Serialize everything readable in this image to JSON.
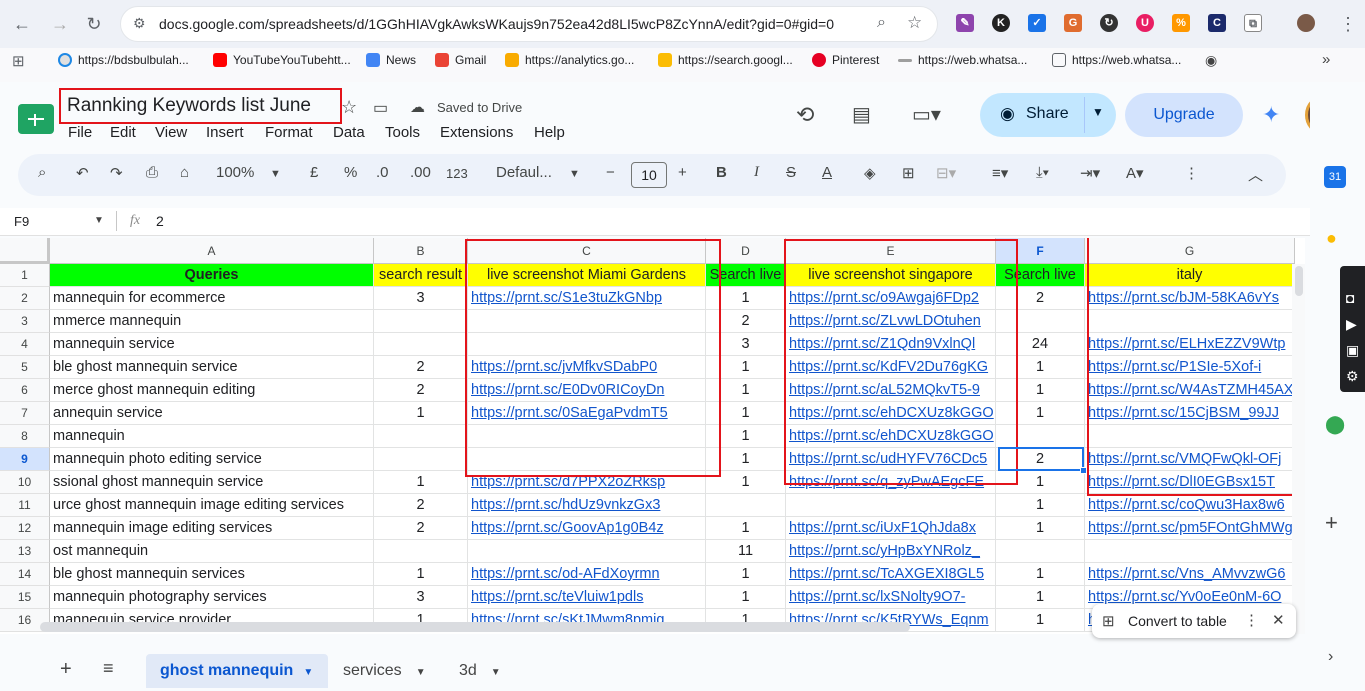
{
  "browser": {
    "url": "docs.google.com/spreadsheets/d/1GGhHIAVgkAwksWKaujs9n752ea42d8LI5wcP8ZcYnnA/edit?gid=0#gid=0",
    "bookmarks": [
      "https://bdsbulbulah...",
      "YouTubeYouTubehtt...",
      "News",
      "Gmail",
      "https://analytics.go...",
      "https://search.googl...",
      "Pinterest",
      "https://web.whatsa...",
      "https://web.whatsa..."
    ],
    "extensions": [
      "K",
      "G",
      "U",
      "M"
    ]
  },
  "doc": {
    "title": "Rannking Keywords list June",
    "saved": "Saved to Drive",
    "menus": [
      "File",
      "Edit",
      "View",
      "Insert",
      "Format",
      "Data",
      "Tools",
      "Extensions",
      "Help"
    ],
    "share": "Share",
    "upgrade": "Upgrade"
  },
  "toolbar": {
    "zoom": "100%",
    "currency": "£",
    "percent": "%",
    "dec_less": ".0",
    "dec_more": ".00",
    "number_fmt": "123",
    "font": "Defaul...",
    "font_size": "10",
    "bold": "B",
    "italic": "I"
  },
  "formula_bar": {
    "cell_ref": "F9",
    "fx": "fx",
    "value": "2"
  },
  "grid": {
    "columns": [
      "A",
      "B",
      "C",
      "D",
      "E",
      "F",
      "G"
    ],
    "rows": [
      "1",
      "2",
      "3",
      "4",
      "5",
      "6",
      "7",
      "8",
      "9",
      "10",
      "11",
      "12",
      "13",
      "14",
      "15",
      "16"
    ],
    "header_row": [
      "Queries",
      "search result",
      "live screenshot Miami Gardens",
      "Search live",
      "live screenshot singapore",
      "Search live",
      "italy"
    ],
    "data": [
      [
        " mannequin for ecommerce",
        "3",
        "https://prnt.sc/S1e3tuZkGNbp",
        "1",
        "https://prnt.sc/o9Awgaj6FDp2",
        "2",
        "https://prnt.sc/bJM-58KA6vYs"
      ],
      [
        "mmerce mannequin",
        "",
        "",
        "2",
        "https://prnt.sc/ZLvwLDOtuhen",
        "",
        ""
      ],
      [
        " mannequin service",
        "",
        "",
        "3",
        "https://prnt.sc/Z1Qdn9VxlnQl",
        "24",
        "https://prnt.sc/ELHxEZZV9Wtp"
      ],
      [
        "ble ghost mannequin service",
        "2",
        "https://prnt.sc/jvMfkvSDabP0",
        "1",
        "https://prnt.sc/KdFV2Du76gKG",
        "1",
        "https://prnt.sc/P1SIe-5Xof-i"
      ],
      [
        "merce ghost mannequin editing",
        "2",
        "https://prnt.sc/E0Dv0RICoyDn",
        "1",
        "https://prnt.sc/aL52MQkvT5-9",
        "1",
        "https://prnt.sc/W4AsTZMH45AX"
      ],
      [
        "annequin service",
        "1",
        "https://prnt.sc/0SaEgaPvdmT5",
        "1",
        "https://prnt.sc/ehDCXUz8kGGO",
        "1",
        "https://prnt.sc/15CjBSM_99JJ"
      ],
      [
        " mannequin",
        "",
        "",
        "1",
        "https://prnt.sc/ehDCXUz8kGGO",
        "",
        ""
      ],
      [
        " mannequin photo editing service",
        "",
        "",
        "1",
        "https://prnt.sc/udHYFV76CDc5",
        "2",
        "https://prnt.sc/VMQFwQkl-OFj"
      ],
      [
        "ssional ghost mannequin service",
        "1",
        "https://prnt.sc/d7PPX2oZRksp",
        "1",
        "https://prnt.sc/q_zyPwAEgcFE",
        "1",
        "https://prnt.sc/DlI0EGBsx15T"
      ],
      [
        "urce ghost mannequin image editing services",
        "2",
        "https://prnt.sc/hdUz9vnkzGx3",
        "",
        "",
        "1",
        "https://prnt.sc/coQwu3Hax8w6"
      ],
      [
        " mannequin image editing services",
        "2",
        "https://prnt.sc/GoovAp1g0B4z",
        "1",
        "https://prnt.sc/iUxF1QhJda8x",
        "1",
        "https://prnt.sc/pm5FOntGhMWg"
      ],
      [
        "ost mannequin",
        "",
        "",
        "11",
        "https://prnt.sc/yHpBxYNRolz_",
        "",
        ""
      ],
      [
        "ble ghost mannequin services",
        "1",
        "https://prnt.sc/od-AFdXoyrmn",
        "1",
        "https://prnt.sc/TcAXGEXI8GL5",
        "1",
        "https://prnt.sc/Vns_AMvvzwG6"
      ],
      [
        " mannequin photography services",
        "3",
        "https://prnt.sc/teVluiw1pdls",
        "1",
        "https://prnt.sc/lxSNolty9O7-",
        "1",
        "https://prnt.sc/Yv0oEe0nM-6O"
      ],
      [
        " mannequin service provider",
        "1",
        "https://prnt.sc/sKtJMwm8pmig",
        "1",
        "https://prnt.sc/K5tRYWs_Eqnm",
        "1",
        "https://prnt.sc/..."
      ]
    ]
  },
  "sheets": {
    "active": "ghost mannequin",
    "others": [
      "services",
      "3d"
    ]
  },
  "convert": "Convert to table",
  "colors": {
    "header_green": "#00ff00",
    "header_yellow": "#ffff00",
    "link": "#1155cc",
    "annotation_red": "#e3141b"
  }
}
